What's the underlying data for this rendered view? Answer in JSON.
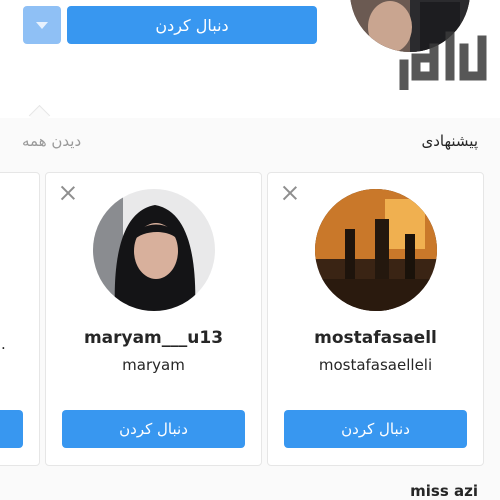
{
  "header": {
    "follow_button_label": "دنبال کردن",
    "dropdown_icon": "chevron-down-icon",
    "watermark_text": "چاپار"
  },
  "suggestions": {
    "title": "پیشنهادی",
    "see_all": "دیدن همه",
    "cards": [
      {
        "username": "mostafasaell",
        "full_name": "mostafasaelleli",
        "follow_label": "دنبال کردن"
      },
      {
        "username": "maryam___u13",
        "full_name": "maryam",
        "follow_label": "دنبال کردن"
      }
    ],
    "partial_card_text": "."
  },
  "next_profile": {
    "username": "miss azi"
  },
  "colors": {
    "accent": "#3897f0",
    "accent_light": "#8fc0f5",
    "text": "#262626",
    "muted": "#999999",
    "border": "#e6e6e6"
  }
}
